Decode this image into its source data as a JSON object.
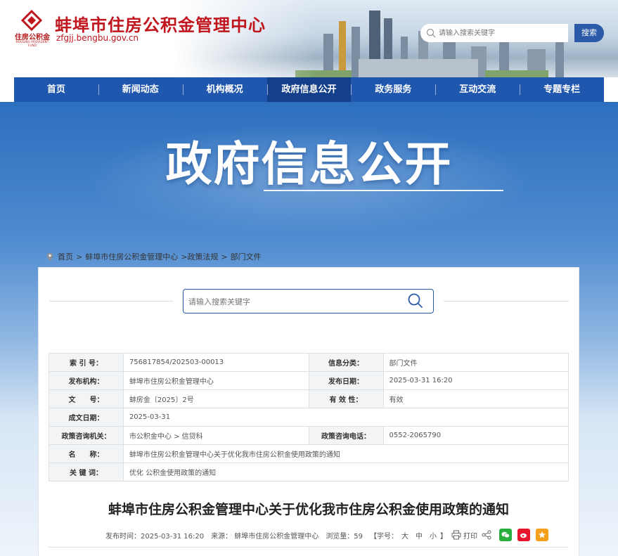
{
  "header": {
    "site_title": "蚌埠市住房公积金管理中心",
    "domain": "zfgjj.bengbu.gov.cn",
    "logo_text": "住房公积金",
    "logo_subtext": "HOUSING PROVIDENT FUND",
    "search_placeholder": "请输入搜索关键字",
    "search_button": "搜索"
  },
  "nav": {
    "items": [
      "首页",
      "新闻动态",
      "机构概况",
      "政府信息公开",
      "政务服务",
      "互动交流",
      "专题专栏"
    ],
    "active_index": 3
  },
  "banner": {
    "title": "政府信息公开"
  },
  "breadcrumb": {
    "items": [
      "首页",
      ">",
      "蚌埠市住房公积金管理中心",
      ">政策法规",
      ">",
      "部门文件"
    ]
  },
  "content_search": {
    "placeholder": "请输入搜索关键字"
  },
  "info_table": {
    "rows": [
      {
        "l1": "索 引 号：",
        "v1": "756817854/202503-00013",
        "l2": "信息分类：",
        "v2": "部门文件"
      },
      {
        "l1": "发布机构：",
        "v1": "蚌埠市住房公积金管理中心",
        "l2": "发布日期：",
        "v2": "2025-03-31 16:20"
      },
      {
        "l1": "文　　号：",
        "v1": "蚌房金〔2025〕2号",
        "l2": "有 效 性：",
        "v2": "有效"
      },
      {
        "l1": "成文日期：",
        "v1": "2025-03-31"
      },
      {
        "l1": "政策咨询机关：",
        "v1": "市公积金中心 > 信贷科",
        "l2": "政策咨询电话：",
        "v2": "0552-2065790"
      },
      {
        "l1": "名　　称：",
        "v1": "蚌埠市住房公积金管理中心关于优化我市住房公积金使用政策的通知"
      },
      {
        "l1": "关 键 词：",
        "v1": "优化 公积金使用政策的通知"
      }
    ]
  },
  "article": {
    "title": "蚌埠市住房公积金管理中心关于优化我市住房公积金使用政策的通知",
    "publish_time": "发布时间：2025-03-31 16:20",
    "source": "来源：  蚌埠市住房公积金管理中心",
    "views": "浏览量：59",
    "font_label": "【字号：",
    "font_large": "大",
    "font_medium": "中",
    "font_small": "小",
    "font_close": "】",
    "print": "打印"
  },
  "colors": {
    "brand_red": "#c0151d",
    "nav_blue": "#1f56ae",
    "nav_active": "#143f8a",
    "wechat": "#2aae3e",
    "weibo": "#e6162d",
    "favorite": "#f4a01c"
  },
  "icons": [
    "search-icon",
    "location-icon",
    "print-icon",
    "share-icon",
    "wechat-icon",
    "weibo-icon",
    "favorite-icon"
  ]
}
